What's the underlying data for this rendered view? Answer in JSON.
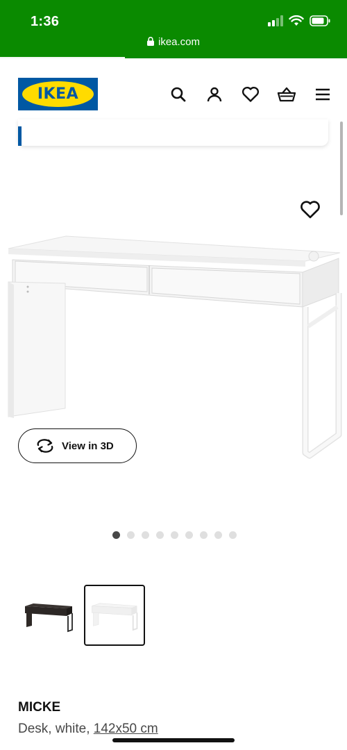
{
  "status": {
    "time": "1:36"
  },
  "browser": {
    "url": "ikea.com"
  },
  "brand": {
    "logo_text": "IKEA",
    "blue": "#0058a3",
    "yellow": "#ffdb00",
    "green": "#0a8a00"
  },
  "header_icons": [
    "search-icon",
    "profile-icon",
    "heart-icon",
    "basket-icon",
    "menu-icon"
  ],
  "product_view": {
    "view3d_label": "View in 3D",
    "image_count": 9,
    "active_image_index": 0
  },
  "variants": [
    {
      "name": "black-brown",
      "selected": false
    },
    {
      "name": "white",
      "selected": true
    }
  ],
  "product": {
    "name": "MICKE",
    "desc_prefix": "Desk, white, ",
    "dimensions": "142x50 cm"
  }
}
